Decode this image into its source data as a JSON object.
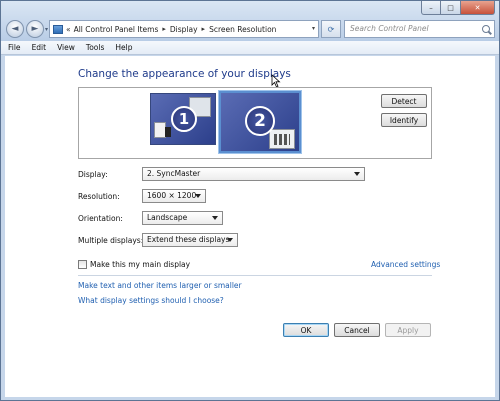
{
  "window": {
    "minimize_glyph": "–",
    "maximize_glyph": "□",
    "close_glyph": "✕"
  },
  "nav": {
    "back_glyph": "◄",
    "forward_glyph": "►",
    "dropdown_glyph": "▾"
  },
  "address": {
    "overflow_glyph": "«",
    "crumbs": [
      "All Control Panel Items",
      "Display",
      "Screen Resolution"
    ],
    "separator_glyph": "▸",
    "refresh_glyph": "⟳"
  },
  "search": {
    "placeholder": "Search Control Panel"
  },
  "menu": {
    "items": [
      "File",
      "Edit",
      "View",
      "Tools",
      "Help"
    ]
  },
  "main": {
    "heading": "Change the appearance of your displays",
    "monitors": [
      {
        "number": "1",
        "selected": false
      },
      {
        "number": "2",
        "selected": true
      }
    ],
    "detect_label": "Detect",
    "identify_label": "Identify"
  },
  "settings": {
    "display": {
      "label": "Display:",
      "value": "2. SyncMaster"
    },
    "resolution": {
      "label": "Resolution:",
      "value": "1600 × 1200"
    },
    "orientation": {
      "label": "Orientation:",
      "value": "Landscape"
    },
    "multiple_displays": {
      "label": "Multiple displays:",
      "value": "Extend these displays"
    }
  },
  "main_display": {
    "label": "Make this my main display",
    "checked": false
  },
  "links": {
    "advanced": "Advanced settings",
    "text_size": "Make text and other items larger or smaller",
    "which_settings": "What display settings should I choose?"
  },
  "footer": {
    "ok_label": "OK",
    "cancel_label": "Cancel",
    "apply_label": "Apply",
    "apply_enabled": false
  },
  "colors": {
    "heading": "#1e3a8a",
    "link": "#1f5fb0",
    "monitor_fill": "#3b4e9b",
    "selected_border": "#5b8fd0"
  }
}
